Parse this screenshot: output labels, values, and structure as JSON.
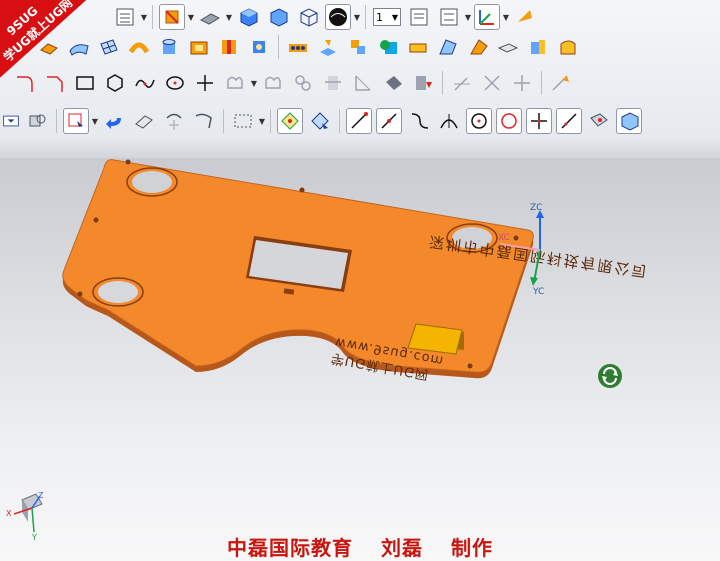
{
  "logo": {
    "brand": "9SUG",
    "slogan": "学UG就上UG网"
  },
  "toolbar": {
    "layer_value": "1",
    "row1_icons": [
      "sketch-icon",
      "list-icon",
      "snap-icon",
      "sheet-metal-icon",
      "solid-block-icon",
      "box-icon",
      "wire-box-icon",
      "render-sphere-icon",
      "layer-select",
      "list-icon",
      "list-icon",
      "wcs-icon",
      "arrow-icon"
    ],
    "row2_icons": [
      "extrude-icon",
      "surface-icon",
      "mesh-icon",
      "sweep-icon",
      "cylinder-icon",
      "pocket-icon",
      "feature-icon",
      "cube-icon",
      "hole-pattern-icon",
      "datum-icon",
      "move-icon",
      "boolean-icon",
      "offset-icon",
      "draft-icon",
      "fold-icon",
      "flange-icon",
      "shell-icon",
      "thicken-icon"
    ],
    "row3_icons": [
      "fillet-curve-icon",
      "chamfer-curve-icon",
      "rectangle-icon",
      "polygon-icon",
      "spline-icon",
      "ellipse-icon",
      "point-icon",
      "profile-icon",
      "offset-curve-icon",
      "bridge-icon",
      "trim-icon",
      "corner-icon",
      "project-icon",
      "extend-icon",
      "line-icon",
      "join-icon",
      "divide-icon",
      "transform-icon"
    ],
    "row4_icons": [
      "filter-icon",
      "layer-icon",
      "select-icon",
      "undo-icon",
      "erase-icon",
      "rotate-icon",
      "measure-icon",
      "selection-box-icon",
      "snap-points-icon",
      "snap-object-icon",
      "line-end-icon",
      "line-mid-icon",
      "arc-icon",
      "tangent-icon",
      "circle-center-icon",
      "quadrant-icon",
      "intersection-icon",
      "perpendicular-icon",
      "face-icon",
      "view-icon"
    ]
  },
  "model": {
    "engraving_company": "深圳市中磊国际科技有限公司",
    "engraving_web": "www.9sug.com",
    "engraving_slogan": "学UG就上UG网"
  },
  "wcs": {
    "zc": "ZC",
    "yc": "YC",
    "xc": "XC"
  },
  "triad": {
    "x": "X",
    "y": "Y",
    "z": "Z"
  },
  "caption": {
    "part1": "中磊国际教育",
    "part2": "刘磊",
    "part3": "制作"
  },
  "colors": {
    "part_fill": "#f4892b",
    "part_edge": "#b8571a",
    "pad": "#f5b400",
    "caption": "#c8150f"
  }
}
